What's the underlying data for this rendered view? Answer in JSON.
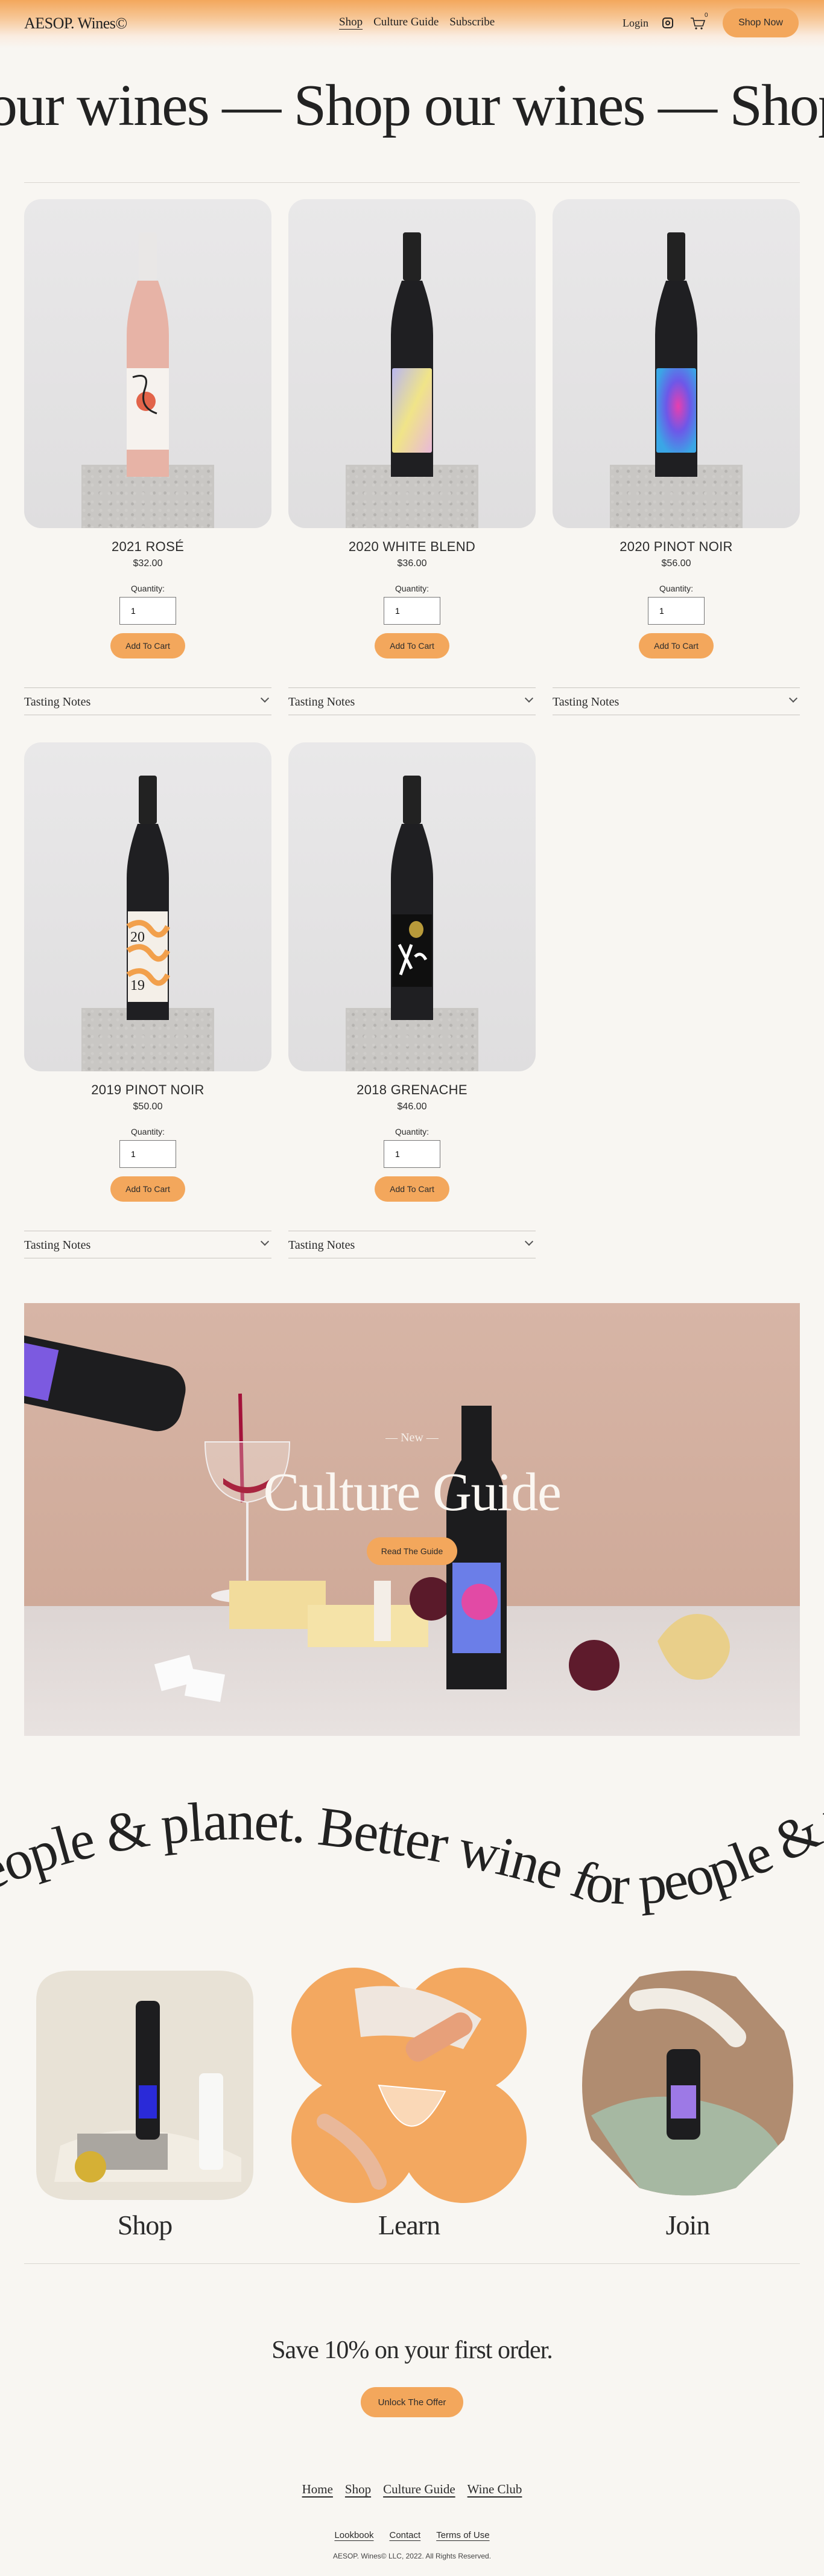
{
  "header": {
    "logo": "AESOP. Wines©",
    "nav": [
      "Shop",
      "Culture Guide",
      "Subscribe"
    ],
    "login": "Login",
    "cart_count": "0",
    "shop_now": "Shop Now"
  },
  "marquee": {
    "text": "our wines — Shop our wines — Shop o"
  },
  "products": [
    {
      "name": "2021 ROSÉ",
      "price": "$32.00",
      "qty_label": "Quantity:",
      "qty": "1",
      "add": "Add To Cart",
      "notes": "Tasting Notes"
    },
    {
      "name": "2020 WHITE BLEND",
      "price": "$36.00",
      "qty_label": "Quantity:",
      "qty": "1",
      "add": "Add To Cart",
      "notes": "Tasting Notes"
    },
    {
      "name": "2020 PINOT NOIR",
      "price": "$56.00",
      "qty_label": "Quantity:",
      "qty": "1",
      "add": "Add To Cart",
      "notes": "Tasting Notes"
    },
    {
      "name": "2019 PINOT NOIR",
      "price": "$50.00",
      "qty_label": "Quantity:",
      "qty": "1",
      "add": "Add To Cart",
      "notes": "Tasting Notes"
    },
    {
      "name": "2018 GRENACHE",
      "price": "$46.00",
      "qty_label": "Quantity:",
      "qty": "1",
      "add": "Add To Cart",
      "notes": "Tasting Notes"
    }
  ],
  "guide": {
    "eyebrow": "— New —",
    "title": "Culture Guide",
    "button": "Read The Guide"
  },
  "curved_text": "people & planet.  Better wine for people & pl",
  "tiles": [
    "Shop",
    "Learn",
    "Join"
  ],
  "offer": {
    "text": "Save 10% on your first order.",
    "button": "Unlock The Offer"
  },
  "footer": {
    "nav": [
      "Home",
      "Shop",
      "Culture Guide",
      "Wine Club"
    ],
    "links": [
      "Lookbook",
      "Contact",
      "Terms of Use"
    ],
    "copyright": "AESOP. Wines© LLC, 2022. All Rights Reserved."
  },
  "colors": {
    "accent": "#f3a75c",
    "background": "#f8f6f2"
  }
}
